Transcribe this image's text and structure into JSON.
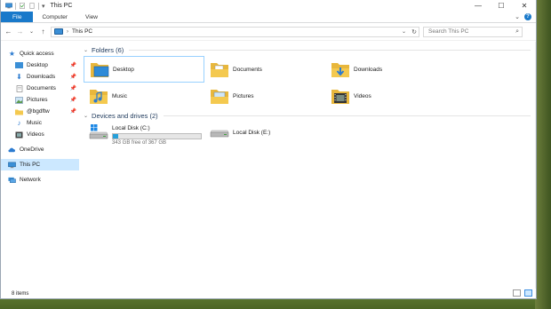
{
  "window": {
    "title": "This PC",
    "controls": {
      "minimize": "—",
      "maximize": "☐",
      "close": "✕"
    }
  },
  "ribbon": {
    "tabs": [
      "File",
      "Computer",
      "View"
    ],
    "collapse": "⌄",
    "help": "?"
  },
  "address": {
    "back": "←",
    "forward": "→",
    "recent": "⌄",
    "up": "↑",
    "path": "This PC",
    "separator": "›",
    "dropdown": "⌄",
    "refresh": "↻"
  },
  "search": {
    "placeholder": "Search This PC"
  },
  "sidebar": {
    "items": [
      {
        "label": "Quick access",
        "icon": "star-icon",
        "sub": false,
        "pinned": false
      },
      {
        "label": "Desktop",
        "icon": "desktop-folder-icon",
        "sub": true,
        "pinned": true
      },
      {
        "label": "Downloads",
        "icon": "download-arrow-icon",
        "sub": true,
        "pinned": true
      },
      {
        "label": "Documents",
        "icon": "documents-icon",
        "sub": true,
        "pinned": true
      },
      {
        "label": "Pictures",
        "icon": "pictures-icon",
        "sub": true,
        "pinned": true
      },
      {
        "label": "@bgdftw",
        "icon": "folder-icon",
        "sub": true,
        "pinned": true
      },
      {
        "label": "Music",
        "icon": "music-note-icon",
        "sub": true,
        "pinned": false
      },
      {
        "label": "Videos",
        "icon": "videos-icon",
        "sub": true,
        "pinned": false
      },
      {
        "label": "OneDrive",
        "icon": "cloud-icon",
        "sub": false,
        "pinned": false
      },
      {
        "label": "This PC",
        "icon": "computer-icon",
        "sub": false,
        "pinned": false,
        "selected": true
      },
      {
        "label": "Network",
        "icon": "network-icon",
        "sub": false,
        "pinned": false
      }
    ]
  },
  "folders_group": {
    "header": "Folders (6)",
    "items": [
      {
        "label": "Desktop",
        "icon": "desktop-folder-icon",
        "selected": true
      },
      {
        "label": "Documents",
        "icon": "documents-folder-icon"
      },
      {
        "label": "Downloads",
        "icon": "downloads-folder-icon"
      },
      {
        "label": "Music",
        "icon": "music-folder-icon"
      },
      {
        "label": "Pictures",
        "icon": "pictures-folder-icon"
      },
      {
        "label": "Videos",
        "icon": "videos-folder-icon"
      }
    ]
  },
  "drives_group": {
    "header": "Devices and drives (2)",
    "items": [
      {
        "label": "Local Disk (C:)",
        "icon": "windows-drive-icon",
        "free_text": "343 GB free of 367 GB",
        "used_fraction": 0.065
      },
      {
        "label": "Local Disk (E:)",
        "icon": "hard-drive-icon"
      }
    ]
  },
  "status": {
    "items_count": "8 items"
  },
  "colors": {
    "accent": "#1979ca",
    "selection": "#cce8ff",
    "folder": "#f4c94f",
    "drive_bar": "#26a0da",
    "group_header": "#1e395b"
  }
}
